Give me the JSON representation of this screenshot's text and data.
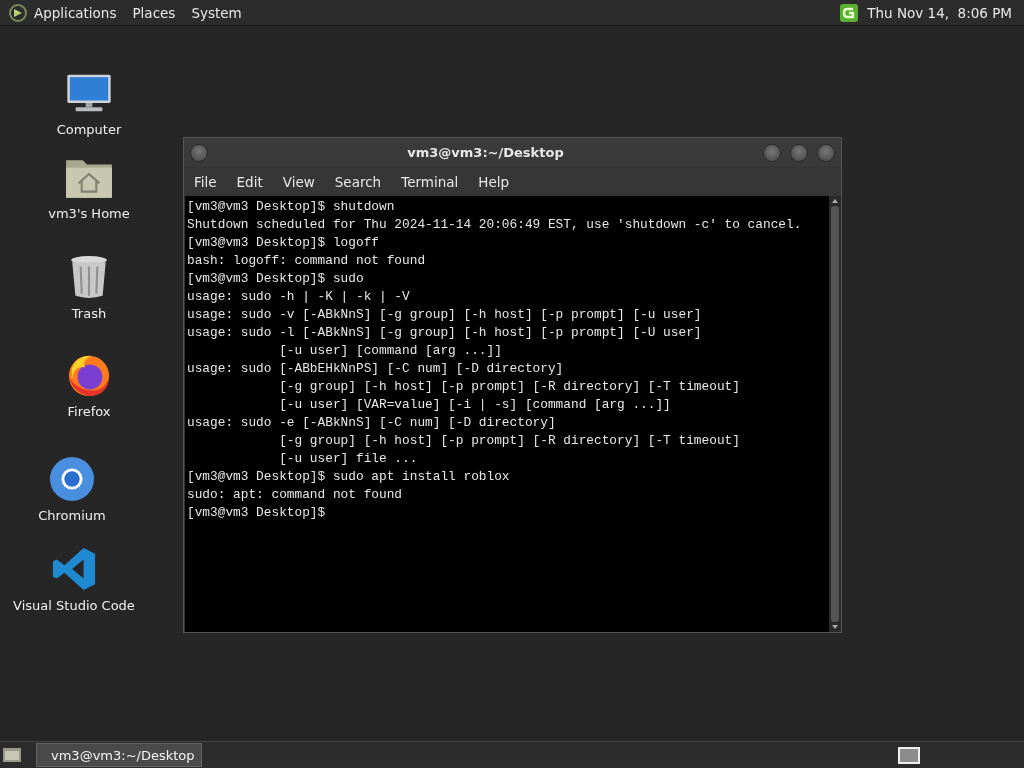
{
  "top_panel": {
    "menus": [
      "Applications",
      "Places",
      "System"
    ],
    "clock": "Thu Nov 14,  8:06 PM"
  },
  "desktop_icons": [
    {
      "kind": "computer",
      "label": "Computer"
    },
    {
      "kind": "home",
      "label": "vm3's Home"
    },
    {
      "kind": "trash",
      "label": "Trash"
    },
    {
      "kind": "firefox",
      "label": "Firefox"
    },
    {
      "kind": "chromium",
      "label": "Chromium"
    },
    {
      "kind": "vscode",
      "label": "Visual Studio Code"
    }
  ],
  "window": {
    "title": "vm3@vm3:~/Desktop",
    "menu": [
      "File",
      "Edit",
      "View",
      "Search",
      "Terminal",
      "Help"
    ],
    "lines": [
      "[vm3@vm3 Desktop]$ shutdown",
      "Shutdown scheduled for Thu 2024-11-14 20:06:49 EST, use 'shutdown -c' to cancel.",
      "[vm3@vm3 Desktop]$ logoff",
      "bash: logoff: command not found",
      "[vm3@vm3 Desktop]$ sudo",
      "usage: sudo -h | -K | -k | -V",
      "usage: sudo -v [-ABkNnS] [-g group] [-h host] [-p prompt] [-u user]",
      "usage: sudo -l [-ABkNnS] [-g group] [-h host] [-p prompt] [-U user]",
      "            [-u user] [command [arg ...]]",
      "usage: sudo [-ABbEHkNnPS] [-C num] [-D directory]",
      "            [-g group] [-h host] [-p prompt] [-R directory] [-T timeout]",
      "            [-u user] [VAR=value] [-i | -s] [command [arg ...]]",
      "usage: sudo -e [-ABkNnS] [-C num] [-D directory]",
      "            [-g group] [-h host] [-p prompt] [-R directory] [-T timeout]",
      "            [-u user] file ...",
      "[vm3@vm3 Desktop]$ sudo apt install roblox",
      "sudo: apt: command not found",
      "[vm3@vm3 Desktop]$"
    ]
  },
  "taskbar": {
    "tasks": [
      {
        "label": "vm3@vm3:~/Desktop",
        "selected": true
      }
    ]
  }
}
